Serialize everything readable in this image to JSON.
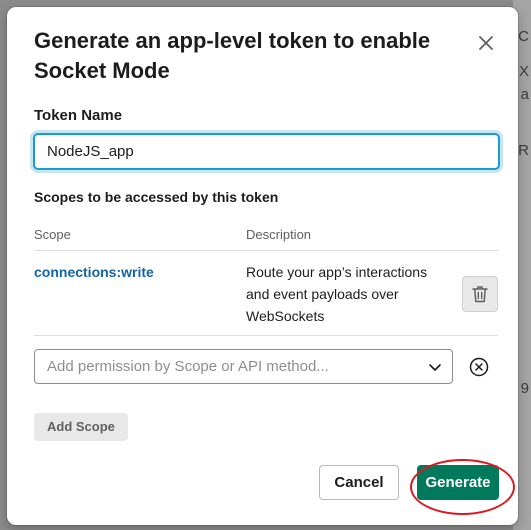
{
  "modal": {
    "title": "Generate an app-level token to enable Socket Mode"
  },
  "token_name": {
    "label": "Token Name",
    "value": "NodeJS_app"
  },
  "scopes": {
    "section_label": "Scopes to be accessed by this token",
    "columns": [
      "Scope",
      "Description"
    ],
    "rows": [
      {
        "scope": "connections:write",
        "description": "Route your app’s interactions and event payloads over WebSockets"
      }
    ],
    "select_placeholder": "Add permission by Scope or API method...",
    "add_button": "Add Scope"
  },
  "footer": {
    "cancel_label": "Cancel",
    "generate_label": "Generate"
  },
  "background": {
    "glyphs": [
      "C",
      "X",
      "a",
      "R",
      "9"
    ]
  },
  "colors": {
    "primary": "#007a5a",
    "link": "#1264a3",
    "focus": "#1d9bd1",
    "highlight": "#d8191f"
  },
  "icons": [
    "close-icon",
    "trash-icon",
    "chevron-down-icon",
    "clear-circle-icon"
  ]
}
